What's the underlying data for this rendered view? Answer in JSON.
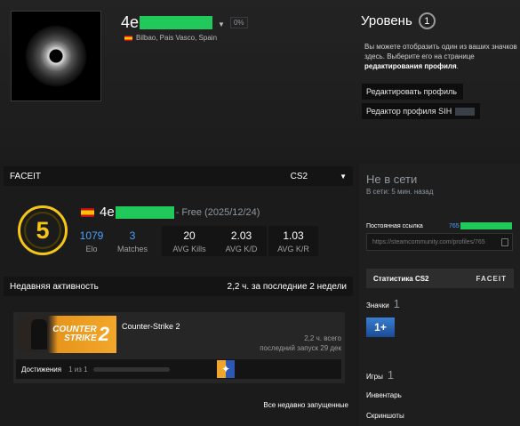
{
  "profile": {
    "name_visible": "4e",
    "level_percent": "0%",
    "location": "Bilbao, Pais Vasco, Spain",
    "level_label": "Уровень",
    "level_value": "1",
    "level_desc_pre": "Вы можете отобразить один из ваших значков здесь. Выберите его на странице",
    "level_desc_link": "редактирования профиля",
    "level_desc_post": ".",
    "edit_profile_btn": "Редактировать профиль",
    "sih_editor_btn": "Редактор профиля SIH"
  },
  "faceit": {
    "title": "FACEIT",
    "game": "CS2",
    "level": "5",
    "name_visible": "4e",
    "free_text": "- Free (2025/12/24)",
    "stats": [
      {
        "value": "1079",
        "label": "Elo"
      },
      {
        "value": "3",
        "label": "Matches"
      },
      {
        "value": "20",
        "label": "AVG Kills"
      },
      {
        "value": "2.03",
        "label": "AVG K/D"
      },
      {
        "value": "1.03",
        "label": "AVG K/R"
      }
    ]
  },
  "recent": {
    "title": "Недавняя активность",
    "summary": "2,2 ч. за последние 2 недели",
    "game": {
      "logo_line1": "COUNTER",
      "logo_line2": "STRIKE",
      "logo_num": "2",
      "name": "Counter-Strike 2",
      "hours": "2,2 ч. всего",
      "last_played": "последний запуск 29 дек",
      "ach_label": "Достижения",
      "ach_count": "1 из 1"
    },
    "view_all": "Все недавно запущенные"
  },
  "sidebar": {
    "status": "Не в сети",
    "last_online": "В сети: 5 мин. назад",
    "permalink_label": "Постоянная ссылка",
    "permalink_id_visible": "765",
    "permalink_url": "https://steamcommunity.com/profiles/765",
    "cs2_stats_btn": "Статистика CS2",
    "faceit_logo": "FACEIT",
    "badges_label": "Значки",
    "badges_count": "1",
    "badge_text": "1+",
    "games_label": "Игры",
    "games_count": "1",
    "inventory_label": "Инвентарь",
    "screenshots_label": "Скриншоты"
  },
  "colors": {
    "faceit_yellow": "#f5c518",
    "link_blue": "#4aa3ff",
    "redaction_green": "#21c85a"
  }
}
